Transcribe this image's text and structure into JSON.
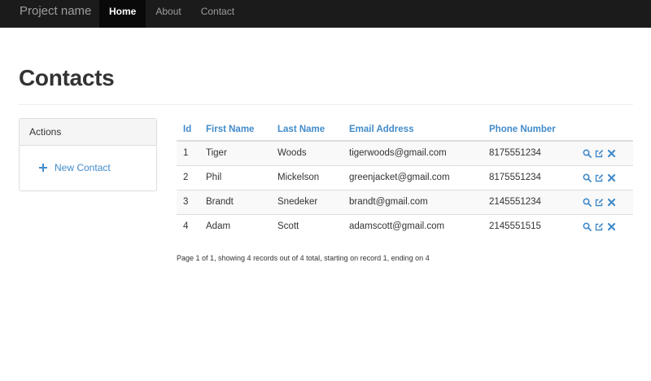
{
  "navbar": {
    "brand": "Project name",
    "items": [
      {
        "label": "Home",
        "active": true
      },
      {
        "label": "About",
        "active": false
      },
      {
        "label": "Contact",
        "active": false
      }
    ]
  },
  "page": {
    "title": "Contacts"
  },
  "actions_panel": {
    "heading": "Actions",
    "new_contact_label": "New Contact",
    "icon": "plus-icon"
  },
  "table": {
    "columns": [
      "Id",
      "First Name",
      "Last Name",
      "Email Address",
      "Phone Number"
    ],
    "rows": [
      {
        "id": "1",
        "first": "Tiger",
        "last": "Woods",
        "email": "tigerwoods@gmail.com",
        "phone": "8175551234"
      },
      {
        "id": "2",
        "first": "Phil",
        "last": "Mickelson",
        "email": "greenjacket@gmail.com",
        "phone": "8175551234"
      },
      {
        "id": "3",
        "first": "Brandt",
        "last": "Snedeker",
        "email": "brandt@gmail.com",
        "phone": "2145551234"
      },
      {
        "id": "4",
        "first": "Adam",
        "last": "Scott",
        "email": "adamscott@gmail.com",
        "phone": "2145551515"
      }
    ],
    "row_action_icons": [
      "search-icon",
      "edit-icon",
      "delete-icon"
    ]
  },
  "pager": {
    "text": "Page 1 of 1, showing 4 records out of 4 total, starting on record 1, ending on 4"
  },
  "colors": {
    "navbar_bg": "#1b1b1b",
    "link": "#428bca",
    "text": "#333333"
  }
}
